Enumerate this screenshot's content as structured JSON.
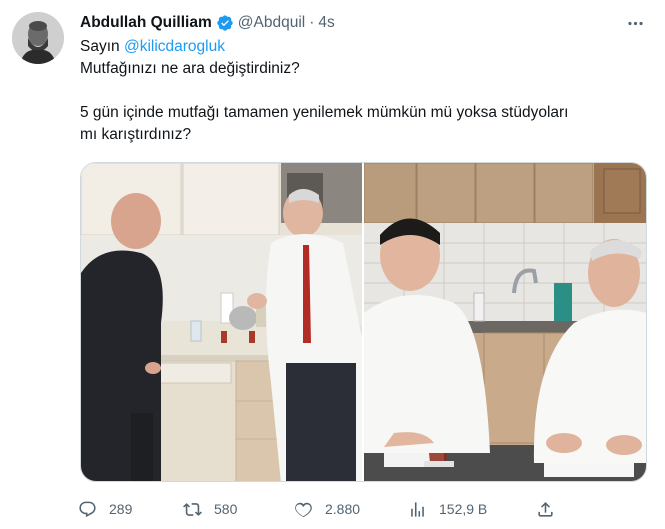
{
  "author": {
    "name": "Abdullah Quilliam",
    "handle": "@Abdquil",
    "time": "4s",
    "verified_color": "#1d9bf0"
  },
  "tweet": {
    "line1_prefix": "Sayın ",
    "mention": "@kilicdarogluk",
    "line2": "Mutfağınızı ne ara değiştirdiniz?",
    "line3": "5 gün içinde mutfağı tamamen yenilemek mümkün mü yoksa stüdyoları",
    "line4": "mı karıştırdınız?"
  },
  "media": {
    "images": [
      {
        "icon": "photo-kitchen-left"
      },
      {
        "icon": "photo-kitchen-right"
      }
    ]
  },
  "actions": {
    "replies": "289",
    "retweets": "580",
    "likes": "2.880",
    "views": "152,9 B"
  },
  "colors": {
    "text": "#0f1419",
    "secondary": "#536471",
    "accent": "#1d9bf0",
    "border": "#cfd9de"
  }
}
